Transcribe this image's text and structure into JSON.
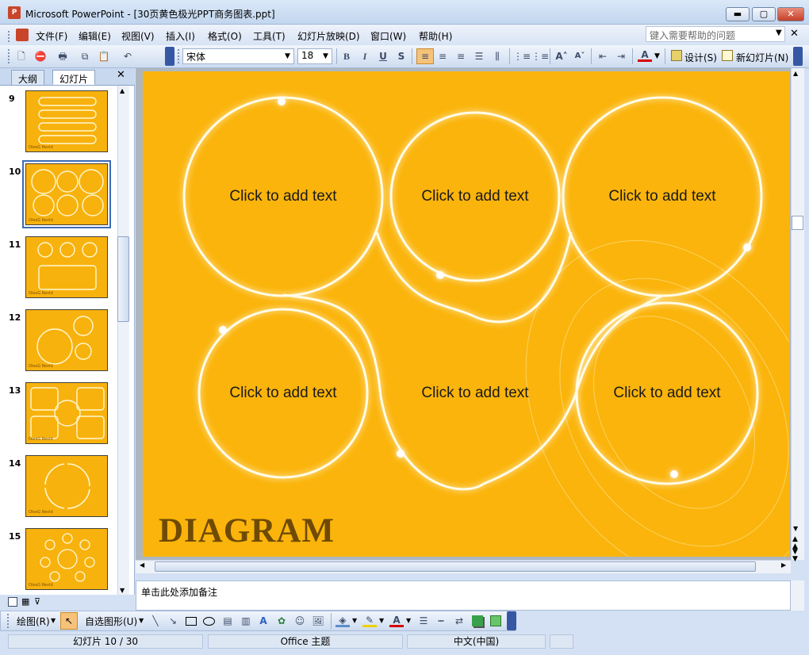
{
  "window": {
    "title": "Microsoft PowerPoint - [30页黄色极光PPT商务图表.ppt]",
    "app_icon": "P",
    "minimize_glyph": "▬",
    "maximize_glyph": "▢",
    "close_glyph": "✕"
  },
  "menu": {
    "items": [
      "文件(F)",
      "编辑(E)",
      "视图(V)",
      "插入(I)",
      "格式(O)",
      "工具(T)",
      "幻灯片放映(D)",
      "窗口(W)",
      "帮助(H)"
    ],
    "help_placeholder": "键入需要帮助的问题",
    "help_close": "✕"
  },
  "toolbar": {
    "font_name": "宋体",
    "font_size": "18",
    "bold": "B",
    "italic": "I",
    "underline": "U",
    "shadow": "S",
    "design_label": "设计(S)",
    "new_slide_label": "新幻灯片(N)"
  },
  "left_panel": {
    "tab_outline": "大纲",
    "tab_slides": "幻灯片",
    "close": "✕",
    "selected_slide": 10,
    "thumbnails": [
      {
        "num": "9",
        "sig": "OlexG RevId"
      },
      {
        "num": "10",
        "sig": "OlexG RevId"
      },
      {
        "num": "11",
        "sig": "OlexG RevId"
      },
      {
        "num": "12",
        "sig": "OlexG RevId"
      },
      {
        "num": "13",
        "sig": "OlexG RevId"
      },
      {
        "num": "14",
        "sig": "OlexG RevId"
      },
      {
        "num": "15",
        "sig": "OlexG RevId"
      }
    ]
  },
  "slide": {
    "placeholders": [
      "Click to add text",
      "Click to add text",
      "Click to add text",
      "Click to add text",
      "Click to add text",
      "Click to add text"
    ],
    "title": "DIAGRAM",
    "background_color": "#fbb40b",
    "title_color": "#6e4a05"
  },
  "notes": {
    "placeholder": "单击此处添加备注"
  },
  "drawing_toolbar": {
    "draw_label": "绘图(R)",
    "autoshape_label": "自选图形(U)"
  },
  "status": {
    "slide_position": "幻灯片 10 / 30",
    "theme": "Office 主题",
    "language": "中文(中国)"
  }
}
